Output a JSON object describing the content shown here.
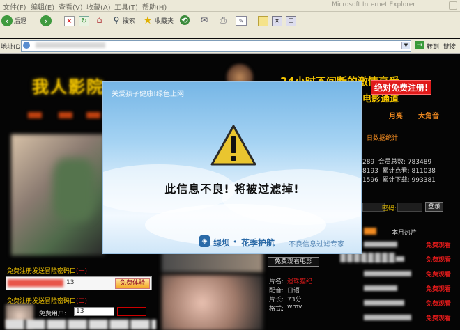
{
  "browser": {
    "menu": [
      "文件(F)",
      "编辑(E)",
      "查看(V)",
      "收藏(A)",
      "工具(T)",
      "帮助(H)"
    ],
    "title": "Microsoft Internet Explorer",
    "toolbar": {
      "back": "后退",
      "search": "搜索",
      "favorites": "收藏夹"
    },
    "address_label": "地址(D)",
    "go_label": "转到",
    "links_label": "链接"
  },
  "site": {
    "logo": "我人影院",
    "slogan": "24小时不间断的激情享受",
    "subtitle": "电影通道",
    "badge": "绝对免费注册!",
    "nav_right": [
      "月亮",
      "大角音"
    ],
    "stats_title": "日数据统计",
    "stats": [
      {
        "a": "289",
        "b": "会员总数: 783489"
      },
      {
        "a": "8193",
        "b": "累计点看: 811038"
      },
      {
        "a": "1596",
        "b": "累计下载: 993381"
      }
    ],
    "password_label": "密码:",
    "login_button": "登录",
    "hot_tab": "本月热片",
    "free_watch": "免费观看",
    "register_notice_1": "免费注册发送冒险密码口",
    "register_notice_1_suffix": "(一)",
    "register_input_value": "13",
    "register_button": "免费体验",
    "register_notice_2": "免费注册发送冒险密码口",
    "register_notice_2_suffix": "(二)",
    "free_user_label": "免费用户:",
    "free_user_value": "13",
    "free_watch_movie": "免费观看电影",
    "movie_info": [
      {
        "k": "片名:",
        "v": "遗珠猫纪"
      },
      {
        "k": "配音:",
        "v": "日语"
      },
      {
        "k": "片长:",
        "v": "73分"
      },
      {
        "k": "格式:",
        "v": "wmv"
      }
    ]
  },
  "filter_overlay": {
    "header": "关爱孩子健康!绿色上网",
    "message": "此信息不良! 将被过滤掉!",
    "brand": "绿坝",
    "brand_sep": "•",
    "brand_2": "花季护航",
    "tagline": "不良信息过滤专家"
  },
  "colors": {
    "accent_yellow": "#f2c400",
    "accent_red": "#e01a1a",
    "overlay_blue": "#2a6aa8"
  }
}
